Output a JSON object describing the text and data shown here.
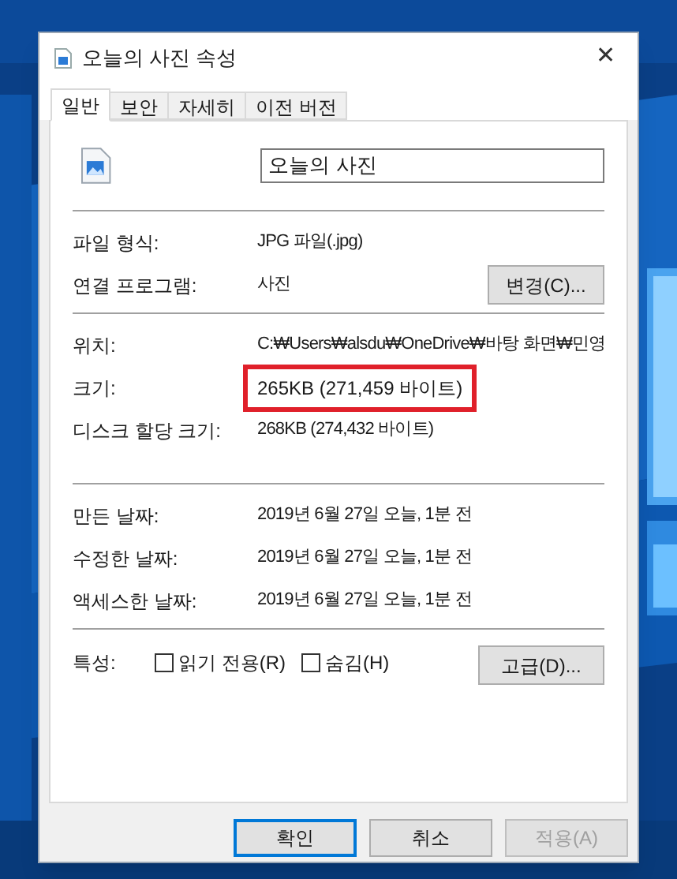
{
  "window": {
    "title": "오늘의 사진 속성",
    "close": "✕"
  },
  "tabs": [
    {
      "label": "일반",
      "selected": true
    },
    {
      "label": "보안",
      "selected": false
    },
    {
      "label": "자세히",
      "selected": false
    },
    {
      "label": "이전 버전",
      "selected": false
    }
  ],
  "file_name": {
    "value": "오늘의 사진"
  },
  "sections": [
    [
      {
        "label": "파일 형식:",
        "value": "JPG 파일(.jpg)",
        "highlighted": false
      },
      {
        "label": "연결 프로그램:",
        "value": "사진",
        "button": "변경(C)...",
        "highlighted": false
      }
    ],
    [
      {
        "label": "위치:",
        "value": "C:₩Users₩alsdu₩OneDrive₩바탕 화면₩민영",
        "highlighted": false
      },
      {
        "label": "크기:",
        "value": "265KB (271,459 바이트)",
        "highlighted": true
      },
      {
        "label": "디스크 할당 크기:",
        "value": "268KB (274,432 바이트)",
        "highlighted": false
      }
    ],
    [
      {
        "label": "만든 날짜:",
        "value": "2019년 6월 27일 오늘, 1분 전",
        "highlighted": false
      },
      {
        "label": "수정한 날짜:",
        "value": "2019년 6월 27일 오늘, 1분 전",
        "highlighted": false
      },
      {
        "label": "액세스한 날짜:",
        "value": "2019년 6월 27일 오늘, 1분 전",
        "highlighted": false
      }
    ]
  ],
  "attributes": {
    "label": "특성:",
    "options": [
      {
        "label": "읽기 전용(R)",
        "checked": false
      },
      {
        "label": "숨김(H)",
        "checked": false
      }
    ],
    "button": "고급(D)..."
  },
  "buttons": [
    {
      "label": "확인",
      "default": true,
      "disabled": false
    },
    {
      "label": "취소",
      "default": false,
      "disabled": false
    },
    {
      "label": "적용(A)",
      "default": false,
      "disabled": true
    }
  ]
}
